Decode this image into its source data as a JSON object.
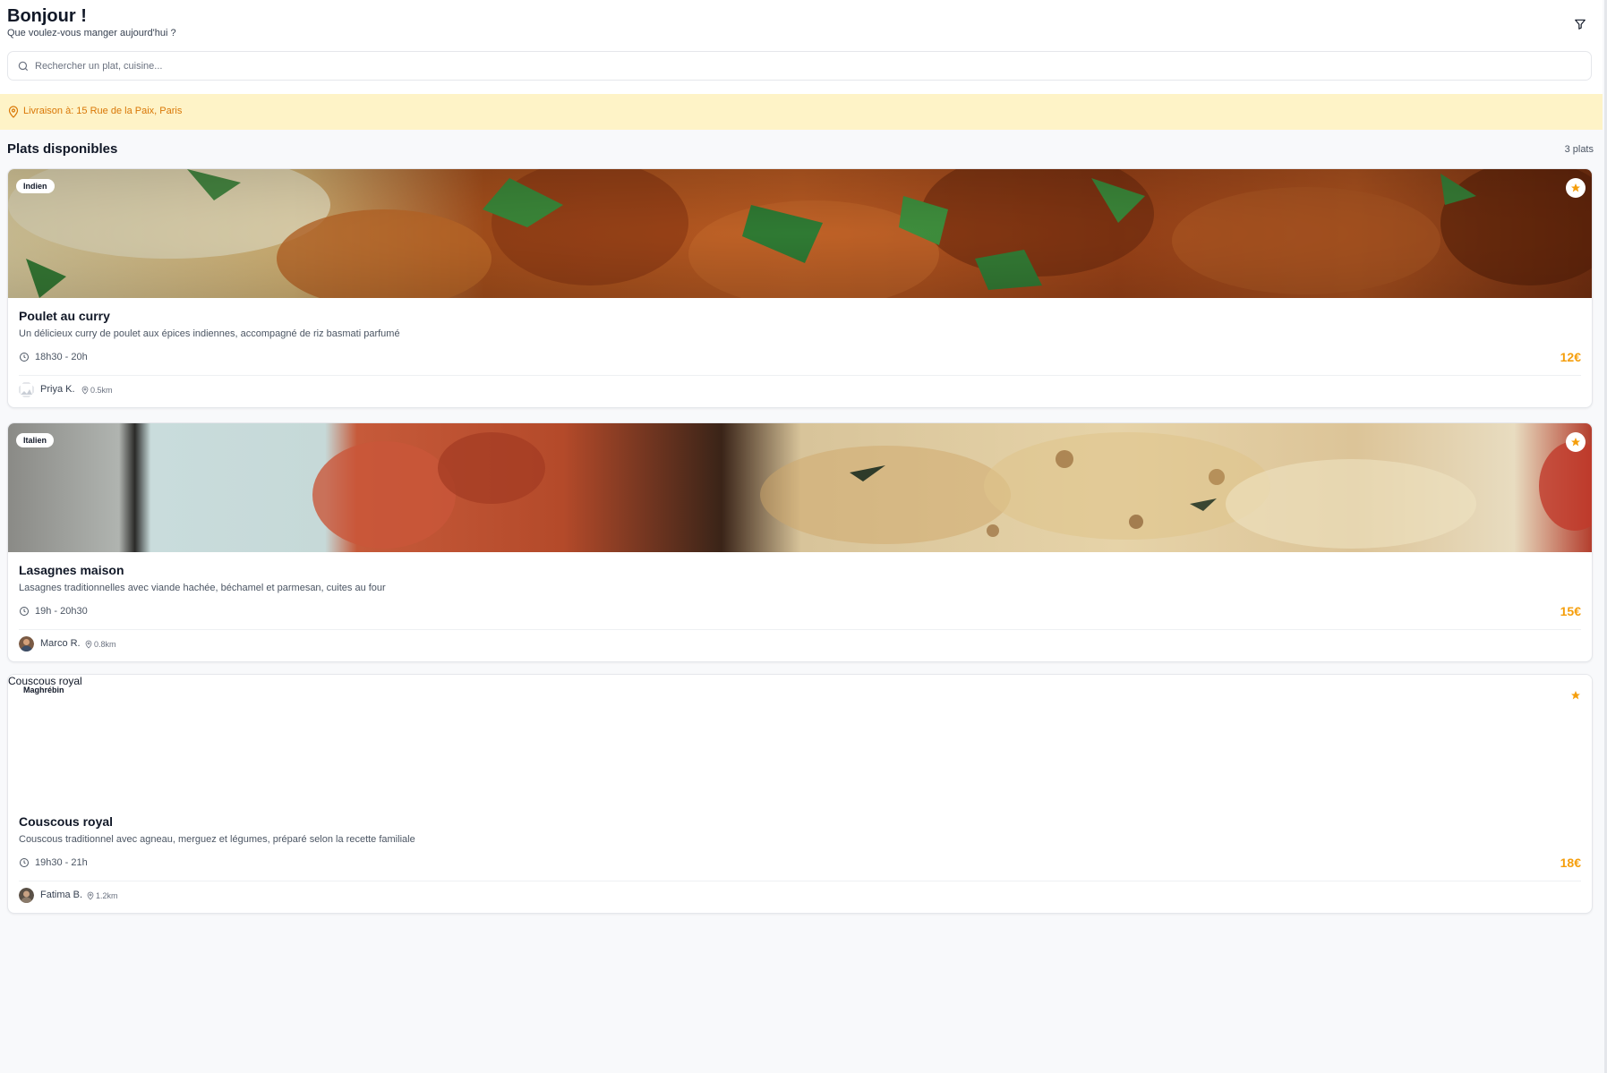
{
  "header": {
    "greeting": "Bonjour !",
    "subgreeting": "Que voulez-vous manger aujourd'hui ?",
    "filter_icon": "filter-icon"
  },
  "search": {
    "placeholder": "Rechercher un plat, cuisine...",
    "value": ""
  },
  "delivery": {
    "text": "Livraison à: 15 Rue de la Paix, Paris",
    "color": "#d97706",
    "background": "#fef3c7"
  },
  "section": {
    "title": "Plats disponibles",
    "count": "3 plats"
  },
  "colors": {
    "accent": "#f59e0b",
    "page_bg": "#f8f9fb"
  },
  "dishes": [
    {
      "cuisine": "Indien",
      "title": "Poulet au curry",
      "description": "Un délicieux curry de poulet aux épices indiennes, accompagné de riz basmati parfumé",
      "time": "18h30 - 20h",
      "price": "12€",
      "cook": "Priya K.",
      "distance": "0.5km",
      "favorite": true
    },
    {
      "cuisine": "Italien",
      "title": "Lasagnes maison",
      "description": "Lasagnes traditionnelles avec viande hachée, béchamel et parmesan, cuites au four",
      "time": "19h - 20h30",
      "price": "15€",
      "cook": "Marco R.",
      "distance": "0.8km",
      "favorite": true
    },
    {
      "cuisine": "Maghrébin",
      "title": "Couscous royal",
      "image_alt": "Couscous royal",
      "description": "Couscous traditionnel avec agneau, merguez et légumes, préparé selon la recette familiale",
      "time": "19h30 - 21h",
      "price": "18€",
      "cook": "Fatima B.",
      "distance": "1.2km",
      "favorite": true
    }
  ]
}
